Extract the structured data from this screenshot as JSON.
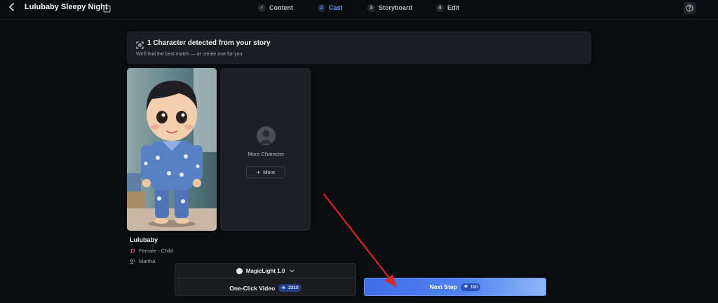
{
  "header": {
    "title": "Lulubaby Sleepy Night",
    "steps": [
      {
        "num": "1",
        "label": "Content",
        "state": "done"
      },
      {
        "num": "2",
        "label": "Cast",
        "state": "active"
      },
      {
        "num": "3",
        "label": "Storyboard",
        "state": "pending"
      },
      {
        "num": "4",
        "label": "Edit",
        "state": "pending"
      }
    ]
  },
  "banner": {
    "title": "1 Character detected from your story",
    "subtitle": "We'll find the best match — or create one for you"
  },
  "character": {
    "name": "Lulubaby",
    "gender_age": "Female - Child",
    "voice": "Martha"
  },
  "more_card": {
    "label": "More Character",
    "button": "More"
  },
  "footer": {
    "model_name": "MagicLight 1.0",
    "one_click_label": "One-Click Video",
    "one_click_credits": "2310",
    "next_label": "Next Step",
    "next_credits": "110"
  },
  "colors": {
    "accent": "#4f83f0",
    "annotation_arrow": "#d9262c",
    "background": "#0b0c0f"
  }
}
